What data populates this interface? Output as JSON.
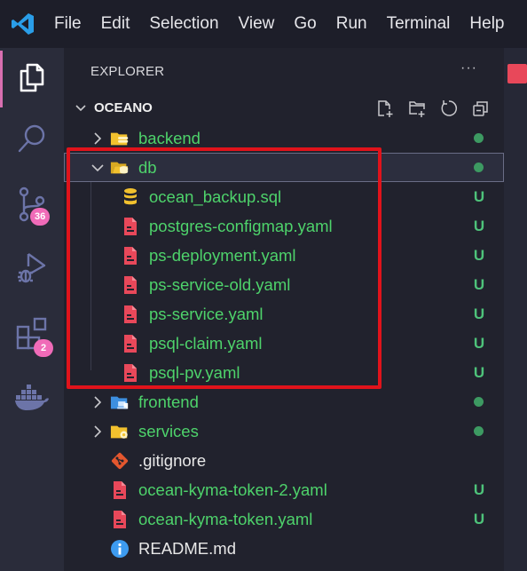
{
  "menubar": {
    "logo_icon": "vscode-logo-icon",
    "items": [
      "File",
      "Edit",
      "Selection",
      "View",
      "Go",
      "Run",
      "Terminal",
      "Help"
    ]
  },
  "activity_bar": {
    "items": [
      {
        "name": "explorer",
        "icon": "files-icon",
        "active": true,
        "badge": null
      },
      {
        "name": "search",
        "icon": "search-icon",
        "active": false,
        "badge": null
      },
      {
        "name": "source-control",
        "icon": "source-control-icon",
        "active": false,
        "badge": "36"
      },
      {
        "name": "run-debug",
        "icon": "run-debug-icon",
        "active": false,
        "badge": null
      },
      {
        "name": "extensions",
        "icon": "extensions-icon",
        "active": false,
        "badge": "2"
      },
      {
        "name": "docker",
        "icon": "docker-icon",
        "active": false,
        "badge": null
      }
    ]
  },
  "explorer": {
    "title": "EXPLORER",
    "more_label": "···",
    "workspace": {
      "name": "OCEANO",
      "actions": [
        "new-file",
        "new-folder",
        "refresh",
        "collapse-all"
      ]
    },
    "tree": [
      {
        "label": "backend",
        "type": "folder",
        "icon": "folder-database",
        "expanded": false,
        "depth": 0,
        "status": "dot",
        "selected": false
      },
      {
        "label": "db",
        "type": "folder",
        "icon": "folder-db-open",
        "expanded": true,
        "depth": 0,
        "status": "dot",
        "selected": true
      },
      {
        "label": "ocean_backup.sql",
        "type": "file",
        "icon": "database",
        "depth": 1,
        "status": "U"
      },
      {
        "label": "postgres-configmap.yaml",
        "type": "file",
        "icon": "yaml",
        "depth": 1,
        "status": "U"
      },
      {
        "label": "ps-deployment.yaml",
        "type": "file",
        "icon": "yaml",
        "depth": 1,
        "status": "U"
      },
      {
        "label": "ps-service-old.yaml",
        "type": "file",
        "icon": "yaml",
        "depth": 1,
        "status": "U"
      },
      {
        "label": "ps-service.yaml",
        "type": "file",
        "icon": "yaml",
        "depth": 1,
        "status": "U"
      },
      {
        "label": "psql-claim.yaml",
        "type": "file",
        "icon": "yaml",
        "depth": 1,
        "status": "U"
      },
      {
        "label": "psql-pv.yaml",
        "type": "file",
        "icon": "yaml",
        "depth": 1,
        "status": "U"
      },
      {
        "label": "frontend",
        "type": "folder",
        "icon": "folder-client",
        "expanded": false,
        "depth": 0,
        "status": "dot"
      },
      {
        "label": "services",
        "type": "folder",
        "icon": "folder-config",
        "expanded": false,
        "depth": 0,
        "status": "dot"
      },
      {
        "label": ".gitignore",
        "type": "file",
        "icon": "git",
        "depth": 0,
        "status": null,
        "plain": true
      },
      {
        "label": "ocean-kyma-token-2.yaml",
        "type": "file",
        "icon": "yaml",
        "depth": 0,
        "status": "U"
      },
      {
        "label": "ocean-kyma-token.yaml",
        "type": "file",
        "icon": "yaml",
        "depth": 0,
        "status": "U"
      },
      {
        "label": "README.md",
        "type": "file",
        "icon": "info",
        "depth": 0,
        "status": null,
        "plain": true
      }
    ]
  },
  "colors": {
    "untracked_green": "#4ed36b",
    "highlight_red": "#e0131b",
    "badge_pink": "#f06bb8",
    "yaml_red": "#e8485a"
  }
}
